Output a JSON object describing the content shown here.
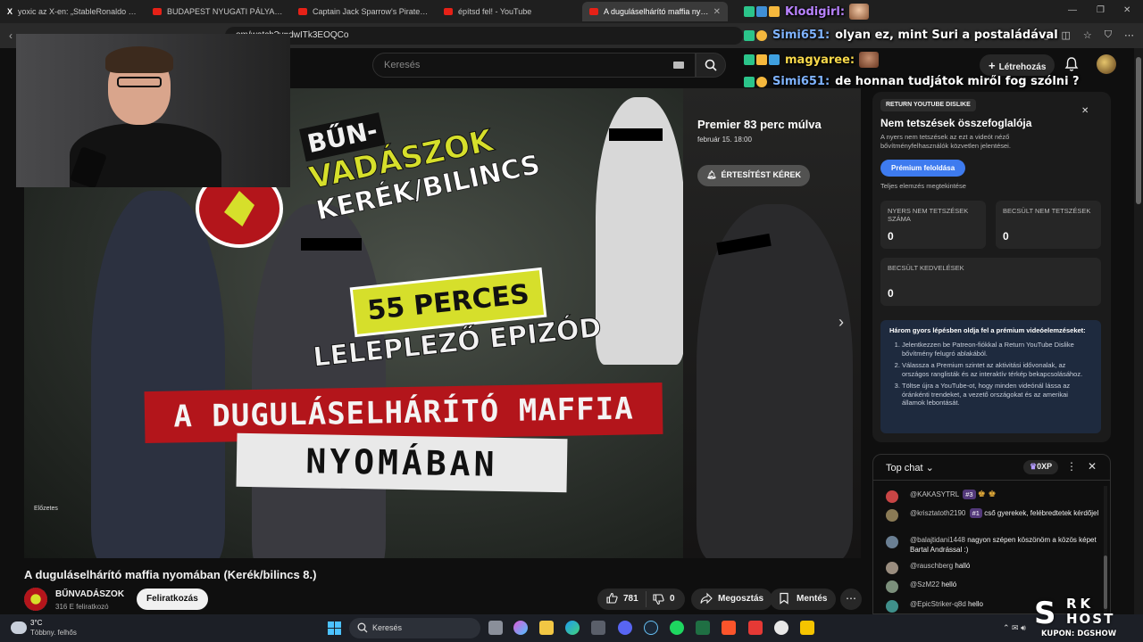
{
  "browser": {
    "tabs": [
      {
        "label": "yoxic az X-en: „StableRonaldo crashe",
        "icon": "x-icon",
        "active": false
      },
      {
        "label": "BUDAPEST NYUGATI PÁLYAUDVA",
        "icon": "youtube-icon",
        "active": false
      },
      {
        "label": "Captain Jack Sparrow's Pirate Ship 10",
        "icon": "youtube-icon",
        "active": false
      },
      {
        "label": "építsd fel! - YouTube",
        "icon": "youtube-icon",
        "active": false
      },
      {
        "label": "A duguláselhárító maffia nyomá",
        "icon": "youtube-icon",
        "active": true
      }
    ],
    "url": "om/watch?v=dwITk3EOQCo"
  },
  "youtube": {
    "search_placeholder": "Keresés",
    "create_label": "Létrehozás"
  },
  "video": {
    "premiere": "Premier 83 perc múlva",
    "premiere_date": "február 15. 18:00",
    "notify_label": "ÉRTESÍTÉST KÉREK",
    "preview_label": "Előzetes",
    "title": "A duguláselhárító maffia nyomában (Kerék/bilincs 8.)",
    "channel": "BŰNVADÁSZOK",
    "subscribers": "316 E feliratkozó",
    "subscribe_label": "Feliratkozás",
    "likes": "781",
    "dislikes": "0",
    "share_label": "Megosztás",
    "save_label": "Mentés",
    "thumbnail": {
      "series_line1": "BŰN-",
      "series_line2": "VADÁSZOK",
      "series_line3": "KERÉK/BILINCS",
      "tag": "55 PERCES",
      "subtitle": "LELEPLEZŐ EPIZÓD",
      "banner1": "A DUGULÁSELHÁRÍTÓ MAFFIA",
      "banner2": "NYOMÁBAN"
    }
  },
  "stream_chat": [
    {
      "user": "Klodigirl:",
      "message": "",
      "color": "#b983ff"
    },
    {
      "user": "Simi651:",
      "message": "olyan ez, mint Suri a postaládával",
      "color": "#7fb3ff"
    },
    {
      "user": "magyaree:",
      "message": "",
      "color": "#f7d84a"
    },
    {
      "user": "Simi651:",
      "message": "de honnan tudjátok miről fog szólni ?",
      "color": "#7fb3ff"
    }
  ],
  "ryd": {
    "badge": "RETURN YOUTUBE DISLIKE",
    "title": "Nem tetszések összefoglalója",
    "description": "A nyers nem tetszések az ezt a videót néző bővítményfelhasználók közvetlen jelentései.",
    "unlock_label": "Prémium feloldása",
    "analysis_link": "Teljes elemzés megtekintése",
    "stats": [
      {
        "label": "NYERS NEM TETSZÉSEK SZÁMA",
        "value": "0"
      },
      {
        "label": "BECSÜLT NEM TETSZÉSEK",
        "value": "0"
      },
      {
        "label": "BECSÜLT KEDVELÉSEK",
        "value": "0"
      }
    ],
    "steps_title": "Három gyors lépésben oldja fel a prémium videóelemzéseket:",
    "steps": [
      "Jelentkezzen be Patreon-fiókkal a Return YouTube Dislike bővítmény felugró ablakából.",
      "Válassza a Premium szintet az aktivitási idővonalak, az országos ranglisták és az interaktív térkép bekapcsolásához.",
      "Töltse újra a YouTube-ot, hogy minden videónál lássa az óránkénti trendeket, a vezető országokat és az amerikai államok lebontását."
    ]
  },
  "live_chat": {
    "header": "Top chat",
    "xp": "0XP",
    "messages": [
      {
        "author": "@KAKASYTRL",
        "badge": "#3",
        "text": "",
        "avatar_color": "#c94545"
      },
      {
        "author": "@krisztatoth2190",
        "badge": "#1",
        "text": "cső gyerekek, felébredtetek kérdőjel",
        "avatar_color": "#8a7a55"
      },
      {
        "author": "@balajtidani1448",
        "badge": "",
        "text": "nagyon szépen köszönöm a közös képet Bartal Andrással :)",
        "avatar_color": "#6a7f93"
      },
      {
        "author": "@rauschberg",
        "badge": "",
        "text": "halló",
        "avatar_color": "#9a8d7f"
      },
      {
        "author": "@SzM22",
        "badge": "",
        "text": "helló",
        "avatar_color": "#7b8f7b"
      },
      {
        "author": "@EpicStriker-q8d",
        "badge": "",
        "text": "hello",
        "avatar_color": "#3f8f8a"
      }
    ]
  },
  "watermark": {
    "letter": "S",
    "line1": "RK",
    "line2": "HOST",
    "coupon": "KUPON: DGSHOW"
  },
  "taskbar": {
    "temperature": "3°C",
    "weather": "Többny. felhős",
    "search_placeholder": "Keresés"
  }
}
